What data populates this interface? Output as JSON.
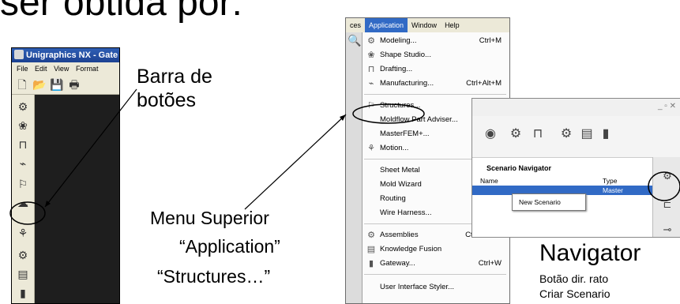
{
  "slide": {
    "title": "ser obtida por:",
    "labels": {
      "barra": "Barra de\nbotões",
      "barra_line1": "Barra de",
      "barra_line2": "botões",
      "menu_superior": "Menu Superior",
      "application": "“Application”",
      "structures": "“Structures…”",
      "navigator": "Navigator",
      "botao": "Botão dir. rato",
      "criar": "Criar Scenario"
    }
  },
  "nx_window": {
    "title": "Unigraphics NX - Gate",
    "menubar": [
      "File",
      "Edit",
      "View",
      "Format"
    ],
    "toolbar_icons": [
      "new-file-icon",
      "open-folder-icon",
      "save-icon",
      "print-icon"
    ],
    "vertical_toolbar_icons": [
      "modeling-icon",
      "shape-studio-icon",
      "drafting-icon",
      "manufacturing-icon",
      "structures-icon",
      "cloud-icon",
      "motion-icon",
      "assemblies-icon",
      "knowledge-icon",
      "gateway-icon"
    ]
  },
  "app_menu": {
    "menubar": [
      "ces",
      "Application",
      "Window",
      "Help"
    ],
    "active": "Application",
    "items": [
      {
        "label": "Modeling...",
        "shortcut": "Ctrl+M",
        "icon": "modeling-icon"
      },
      {
        "label": "Shape Studio...",
        "shortcut": "",
        "icon": "shape-studio-icon"
      },
      {
        "label": "Drafting...",
        "shortcut": "",
        "icon": "drafting-icon"
      },
      {
        "label": "Manufacturing...",
        "shortcut": "Ctrl+Alt+M",
        "icon": "manufacturing-icon"
      },
      {
        "label": "Structures...",
        "shortcut": "",
        "icon": "structures-icon"
      },
      {
        "label": "Moldflow Part Adviser...",
        "shortcut": "",
        "icon": ""
      },
      {
        "label": "MasterFEM+...",
        "shortcut": "",
        "icon": ""
      },
      {
        "label": "Motion...",
        "shortcut": "",
        "icon": "motion-icon"
      },
      {
        "label": "Sheet Metal",
        "shortcut": "",
        "icon": ""
      },
      {
        "label": "Mold Wizard",
        "shortcut": "",
        "icon": ""
      },
      {
        "label": "Routing",
        "shortcut": "",
        "icon": ""
      },
      {
        "label": "Wire Harness...",
        "shortcut": "",
        "icon": ""
      },
      {
        "label": "Assemblies",
        "shortcut": "Ctrl+Alt+W",
        "icon": "assemblies-icon"
      },
      {
        "label": "Knowledge Fusion",
        "shortcut": "",
        "icon": "knowledge-icon"
      },
      {
        "label": "Gateway...",
        "shortcut": "Ctrl+W",
        "icon": "gateway-icon"
      },
      {
        "label": "User Interface Styler...",
        "shortcut": "",
        "icon": ""
      }
    ]
  },
  "navigator": {
    "header": "Scenario Navigator",
    "col_name": "Name",
    "col_type": "Type",
    "row_type": "Master",
    "context_menu_item": "New Scenario"
  }
}
